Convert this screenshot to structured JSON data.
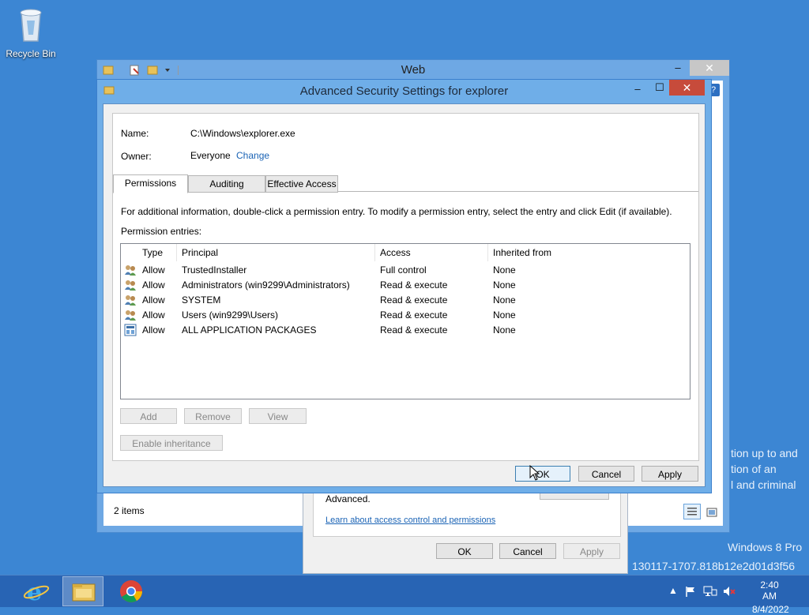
{
  "desktop": {
    "recycle_bin_label": "Recycle Bin",
    "watermark": {
      "line1": "tion up to and",
      "line2": "tion of an",
      "line3": "l and criminal",
      "os_name": "Windows 8 Pro",
      "build": "130117-1707.818b12e2d01d3f56"
    }
  },
  "explorer_window": {
    "title": "Web",
    "status_items": "2 items"
  },
  "properties_dialog": {
    "text": "Advanced.",
    "link": "Learn about access control and permissions",
    "ok_label": "OK",
    "cancel_label": "Cancel",
    "apply_label": "Apply"
  },
  "advanced_dialog": {
    "title": "Advanced Security Settings for explorer",
    "name_label": "Name:",
    "name_value": "C:\\Windows\\explorer.exe",
    "owner_label": "Owner:",
    "owner_value": "Everyone",
    "change_link": "Change",
    "tabs": [
      {
        "label": "Permissions",
        "active": true
      },
      {
        "label": "Auditing",
        "active": false
      },
      {
        "label": "Effective Access",
        "active": false
      }
    ],
    "info_text": "For additional information, double-click a permission entry. To modify a permission entry, select the entry and click Edit (if available).",
    "entries_label": "Permission entries:",
    "columns": [
      "Type",
      "Principal",
      "Access",
      "Inherited from"
    ],
    "entries": [
      {
        "type": "Allow",
        "principal": "TrustedInstaller",
        "access": "Full control",
        "inherited": "None",
        "icon": "users-icon"
      },
      {
        "type": "Allow",
        "principal": "Administrators (win9299\\Administrators)",
        "access": "Read & execute",
        "inherited": "None",
        "icon": "users-icon"
      },
      {
        "type": "Allow",
        "principal": "SYSTEM",
        "access": "Read & execute",
        "inherited": "None",
        "icon": "users-icon"
      },
      {
        "type": "Allow",
        "principal": "Users (win9299\\Users)",
        "access": "Read & execute",
        "inherited": "None",
        "icon": "users-icon"
      },
      {
        "type": "Allow",
        "principal": "ALL APPLICATION PACKAGES",
        "access": "Read & execute",
        "inherited": "None",
        "icon": "app-package-icon"
      }
    ],
    "buttons": {
      "add": "Add",
      "remove": "Remove",
      "view": "View",
      "enable_inheritance": "Enable inheritance",
      "ok": "OK",
      "cancel": "Cancel",
      "apply": "Apply"
    }
  },
  "taskbar": {
    "apps": [
      "internet-explorer-icon",
      "file-explorer-icon",
      "chrome-icon"
    ],
    "time": "2:40 AM",
    "date": "8/4/2022"
  }
}
